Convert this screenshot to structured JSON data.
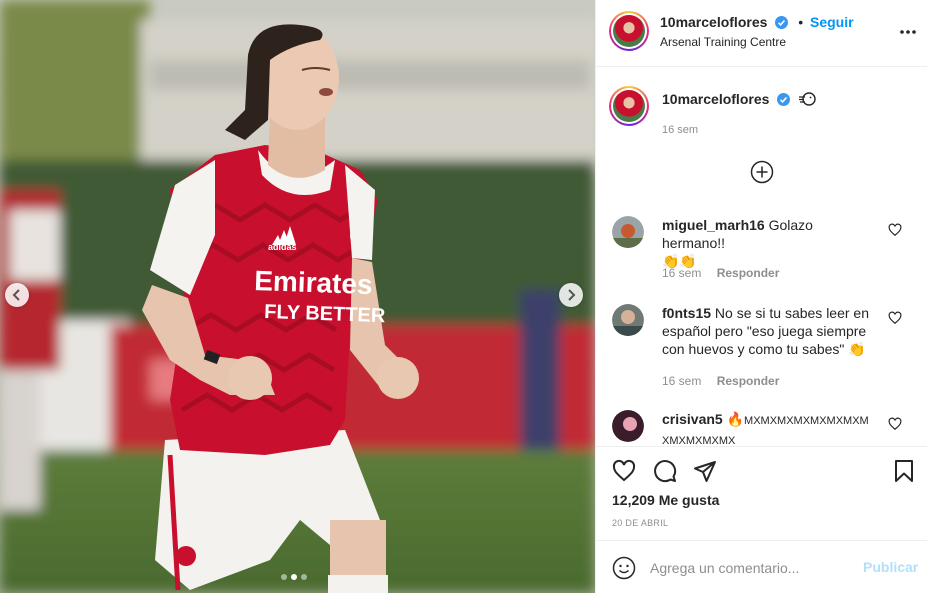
{
  "post": {
    "author": "10marceloflores",
    "follow_label": "Seguir",
    "follow_separator": "•",
    "location": "Arsenal Training Centre",
    "caption_icon": "wind-face-emoji",
    "caption_time": "16 sem",
    "photo": {
      "shirt_sponsor_line1": "Emirates",
      "shirt_sponsor_line2": "FLY BETTER",
      "shirt_brand": "adidas",
      "carousel_dots": 3,
      "active_dot": 2
    }
  },
  "comments": [
    {
      "user": "miguel_marh16",
      "text": "Golazo hermano!!",
      "emoji": "👏👏",
      "time": "16 sem",
      "reply_label": "Responder"
    },
    {
      "user": "f0nts15",
      "text": "No se si tu sabes leer en español pero \"eso juega siempre con huevos y como tu sabes\"",
      "emoji": "👏",
      "time": "16 sem",
      "reply_label": "Responder"
    },
    {
      "user": "crisivan5",
      "emoji": "🔥",
      "text": "MXMXMXMXMXMXMXMXMXMXMXMX"
    }
  ],
  "footer": {
    "likes": "12,209 Me gusta",
    "date": "20 DE ABRIL",
    "comment_placeholder": "Agrega un comentario...",
    "publish_label": "Publicar"
  },
  "colors": {
    "accent": "#0095f6",
    "publish_disabled": "#b2dffc",
    "secondary_text": "#8e8e8e",
    "shirt_red": "#c8102e"
  },
  "icons": [
    "chevron-left-icon",
    "chevron-right-icon",
    "verified-badge-icon",
    "more-options-icon",
    "add-circle-icon",
    "heart-icon",
    "comment-icon",
    "share-icon",
    "bookmark-icon",
    "emoji-icon"
  ]
}
